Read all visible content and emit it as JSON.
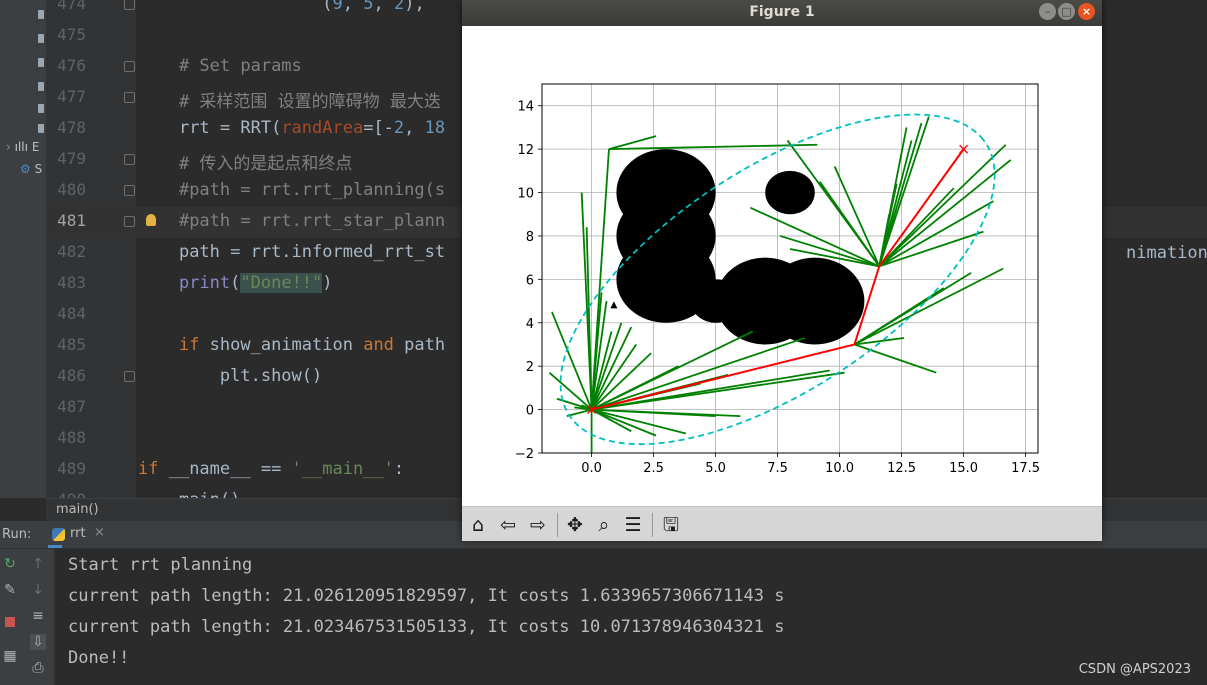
{
  "project": {
    "items": [
      "E",
      "S"
    ]
  },
  "editor": {
    "lines": [
      {
        "num": "474",
        "indent": "                  ",
        "parts": [
          {
            "t": "(",
            "c": ""
          },
          {
            "t": "9",
            "c": "num"
          },
          {
            "t": ", ",
            "c": ""
          },
          {
            "t": "5",
            "c": "num"
          },
          {
            "t": ", ",
            "c": ""
          },
          {
            "t": "2",
            "c": "num"
          },
          {
            "t": "),",
            "c": ""
          }
        ]
      },
      {
        "num": "475",
        "indent": "",
        "parts": []
      },
      {
        "num": "476",
        "indent": "    ",
        "parts": [
          {
            "t": "# Set params",
            "c": "comment"
          }
        ]
      },
      {
        "num": "477",
        "indent": "    ",
        "parts": [
          {
            "t": "# 采样范围 设置的障碍物 最大迭",
            "c": "comment"
          }
        ]
      },
      {
        "num": "478",
        "indent": "    ",
        "parts": [
          {
            "t": "rrt = RRT(",
            "c": ""
          },
          {
            "t": "randArea",
            "c": "param"
          },
          {
            "t": "=[-",
            "c": ""
          },
          {
            "t": "2",
            "c": "num"
          },
          {
            "t": ", ",
            "c": ""
          },
          {
            "t": "18",
            "c": "num"
          }
        ]
      },
      {
        "num": "479",
        "indent": "    ",
        "parts": [
          {
            "t": "# 传入的是起点和终点",
            "c": "comment"
          }
        ]
      },
      {
        "num": "480",
        "indent": "    ",
        "parts": [
          {
            "t": "#path = rrt.rrt_planning(s",
            "c": "comment"
          }
        ]
      },
      {
        "num": "481",
        "indent": "    ",
        "parts": [
          {
            "t": "#path = rrt.rrt_star_plann",
            "c": "comment"
          }
        ]
      },
      {
        "num": "482",
        "indent": "    ",
        "parts": [
          {
            "t": "path = rrt.informed_rrt_st",
            "c": ""
          }
        ]
      },
      {
        "num": "483",
        "indent": "    ",
        "parts": [
          {
            "t": "print",
            "c": "builtin"
          },
          {
            "t": "(",
            "c": ""
          },
          {
            "t": "\"Done!!\"",
            "c": "str-hl"
          },
          {
            "t": ")",
            "c": ""
          }
        ]
      },
      {
        "num": "484",
        "indent": "",
        "parts": []
      },
      {
        "num": "485",
        "indent": "    ",
        "parts": [
          {
            "t": "if ",
            "c": "kw"
          },
          {
            "t": "show_animation ",
            "c": ""
          },
          {
            "t": "and ",
            "c": "kw"
          },
          {
            "t": "path",
            "c": ""
          }
        ]
      },
      {
        "num": "486",
        "indent": "        ",
        "parts": [
          {
            "t": "plt.show()",
            "c": ""
          }
        ]
      },
      {
        "num": "487",
        "indent": "",
        "parts": []
      },
      {
        "num": "488",
        "indent": "",
        "parts": []
      },
      {
        "num": "489",
        "indent": "",
        "parts": [
          {
            "t": "if ",
            "c": "kw"
          },
          {
            "t": "__name__ == ",
            "c": ""
          },
          {
            "t": "'__main__'",
            "c": "str"
          },
          {
            "t": ":",
            "c": ""
          }
        ]
      },
      {
        "num": "490",
        "indent": "    ",
        "parts": [
          {
            "t": "main()",
            "c": ""
          }
        ]
      }
    ],
    "current_line": "481",
    "right_overflow_text": "nimation)"
  },
  "breadcrumb": {
    "text": "main()"
  },
  "run": {
    "label": "Run:",
    "tab": "rrt",
    "tab_close": "×",
    "console": [
      "Start rrt planning",
      "current path length: 21.026120951829597, It costs 1.6339657306671143 s",
      "current path length: 21.023467531505133, It costs 10.071378946304321 s",
      "Done!!"
    ]
  },
  "watermark": "CSDN @APS2023",
  "figure": {
    "title": "Figure 1",
    "toolbar_icons": [
      "home-icon",
      "back-icon",
      "forward-icon",
      "pan-icon",
      "zoom-icon",
      "configure-subplots-icon",
      "save-icon"
    ]
  },
  "colors": {
    "tree": "#008000",
    "path": "#ff0000",
    "ellipse": "#00bfbf",
    "obstacle": "#000000",
    "goal": "#ff0000"
  },
  "chart_data": {
    "type": "scatter",
    "xlim": [
      -2,
      18
    ],
    "ylim": [
      -2,
      15
    ],
    "xticks": [
      "0.0",
      "2.5",
      "5.0",
      "7.5",
      "10.0",
      "12.5",
      "15.0",
      "17.5"
    ],
    "yticks": [
      "−2",
      "0",
      "2",
      "4",
      "6",
      "8",
      "10",
      "12",
      "14"
    ],
    "grid": true,
    "start": [
      0,
      0
    ],
    "goal": [
      15,
      12
    ],
    "obstacles": [
      [
        3,
        6,
        2
      ],
      [
        3,
        8,
        2
      ],
      [
        3,
        10,
        2
      ],
      [
        5,
        5,
        1
      ],
      [
        7,
        5,
        2
      ],
      [
        9,
        5,
        2
      ],
      [
        8,
        10,
        1
      ]
    ],
    "sample_point": [
      0.9,
      4.8
    ],
    "path": [
      [
        0,
        0
      ],
      [
        10.6,
        3.0
      ],
      [
        11.6,
        6.6
      ],
      [
        15,
        12
      ]
    ],
    "ellipse": {
      "center": [
        7.5,
        6.0
      ],
      "semi_major": 10.5,
      "semi_minor": 4.9,
      "angle_deg": 38.66
    },
    "tree_edges": [
      [
        [
          0,
          0
        ],
        [
          -0.2,
          8.4
        ]
      ],
      [
        [
          0,
          0
        ],
        [
          -1.6,
          4.5
        ]
      ],
      [
        [
          0,
          0
        ],
        [
          -1.7,
          1.7
        ]
      ],
      [
        [
          0,
          0
        ],
        [
          -1.4,
          0.5
        ]
      ],
      [
        [
          0,
          0
        ],
        [
          0,
          -2
        ]
      ],
      [
        [
          0,
          0
        ],
        [
          0.4,
          5.4
        ]
      ],
      [
        [
          0,
          0
        ],
        [
          0.6,
          5.0
        ]
      ],
      [
        [
          0,
          0
        ],
        [
          0.8,
          3.6
        ]
      ],
      [
        [
          0,
          0
        ],
        [
          1.2,
          4.0
        ]
      ],
      [
        [
          0,
          0
        ],
        [
          1.6,
          3.8
        ]
      ],
      [
        [
          0,
          0
        ],
        [
          1.8,
          3.0
        ]
      ],
      [
        [
          0,
          0
        ],
        [
          2.4,
          2.6
        ]
      ],
      [
        [
          0,
          0
        ],
        [
          3.5,
          2.0
        ]
      ],
      [
        [
          0,
          0
        ],
        [
          4.4,
          1.2
        ]
      ],
      [
        [
          0,
          0
        ],
        [
          2.6,
          -1.2
        ]
      ],
      [
        [
          0,
          0
        ],
        [
          3.8,
          -1.1
        ]
      ],
      [
        [
          0,
          0
        ],
        [
          5.0,
          -0.3
        ]
      ],
      [
        [
          0,
          0
        ],
        [
          6.0,
          -0.3
        ]
      ],
      [
        [
          0,
          0
        ],
        [
          -0.7,
          0.1
        ]
      ],
      [
        [
          0,
          0
        ],
        [
          -1.0,
          -0.3
        ]
      ],
      [
        [
          0,
          0
        ],
        [
          0.8,
          -0.5
        ]
      ],
      [
        [
          0,
          0
        ],
        [
          1.6,
          -1.0
        ]
      ],
      [
        [
          0,
          0
        ],
        [
          -0.4,
          0.2
        ]
      ],
      [
        [
          0.7,
          12
        ],
        [
          2.6,
          12.6
        ]
      ],
      [
        [
          0.7,
          12
        ],
        [
          9.1,
          12.2
        ]
      ],
      [
        [
          0.7,
          12
        ],
        [
          0.0,
          0.0
        ]
      ],
      [
        [
          -0.4,
          10
        ],
        [
          0.0,
          0.0
        ]
      ],
      [
        [
          0,
          0
        ],
        [
          6.5,
          3.6
        ]
      ],
      [
        [
          0,
          0
        ],
        [
          8.6,
          3.3
        ]
      ],
      [
        [
          0,
          0
        ],
        [
          9.6,
          1.8
        ]
      ],
      [
        [
          0,
          0
        ],
        [
          10.2,
          1.7
        ]
      ],
      [
        [
          0,
          0
        ],
        [
          5.5,
          1.6
        ]
      ],
      [
        [
          10.6,
          3.0
        ],
        [
          13.9,
          1.7
        ]
      ],
      [
        [
          10.6,
          3.0
        ],
        [
          12.6,
          3.3
        ]
      ],
      [
        [
          10.6,
          3.0
        ],
        [
          15.3,
          6.3
        ]
      ],
      [
        [
          10.6,
          3.0
        ],
        [
          14.2,
          5.6
        ]
      ],
      [
        [
          11.6,
          6.6
        ],
        [
          6.4,
          9.3
        ]
      ],
      [
        [
          11.6,
          6.6
        ],
        [
          9.8,
          11.2
        ]
      ],
      [
        [
          11.6,
          6.6
        ],
        [
          7.9,
          12.4
        ]
      ],
      [
        [
          11.6,
          6.6
        ],
        [
          9.2,
          10.5
        ]
      ],
      [
        [
          11.6,
          6.6
        ],
        [
          8.0,
          7.4
        ]
      ],
      [
        [
          11.6,
          6.6
        ],
        [
          7.6,
          8.0
        ]
      ],
      [
        [
          11.6,
          6.6
        ],
        [
          13.3,
          13.2
        ]
      ],
      [
        [
          11.6,
          6.6
        ],
        [
          13.6,
          13.5
        ]
      ],
      [
        [
          11.6,
          6.6
        ],
        [
          12.7,
          13.0
        ]
      ],
      [
        [
          11.6,
          6.6
        ],
        [
          12.9,
          12.4
        ]
      ],
      [
        [
          11.6,
          6.6
        ],
        [
          12.3,
          10.4
        ]
      ],
      [
        [
          11.6,
          6.6
        ],
        [
          12.0,
          9.0
        ]
      ],
      [
        [
          11.6,
          6.6
        ],
        [
          16.7,
          12.2
        ]
      ],
      [
        [
          11.6,
          6.6
        ],
        [
          16.2,
          9.6
        ]
      ],
      [
        [
          11.6,
          6.6
        ],
        [
          15.8,
          8.2
        ]
      ],
      [
        [
          11.6,
          6.6
        ],
        [
          16.9,
          11.5
        ]
      ],
      [
        [
          11.6,
          6.6
        ],
        [
          14.6,
          10.2
        ]
      ],
      [
        [
          10.6,
          3.0
        ],
        [
          16.6,
          6.5
        ]
      ]
    ]
  }
}
